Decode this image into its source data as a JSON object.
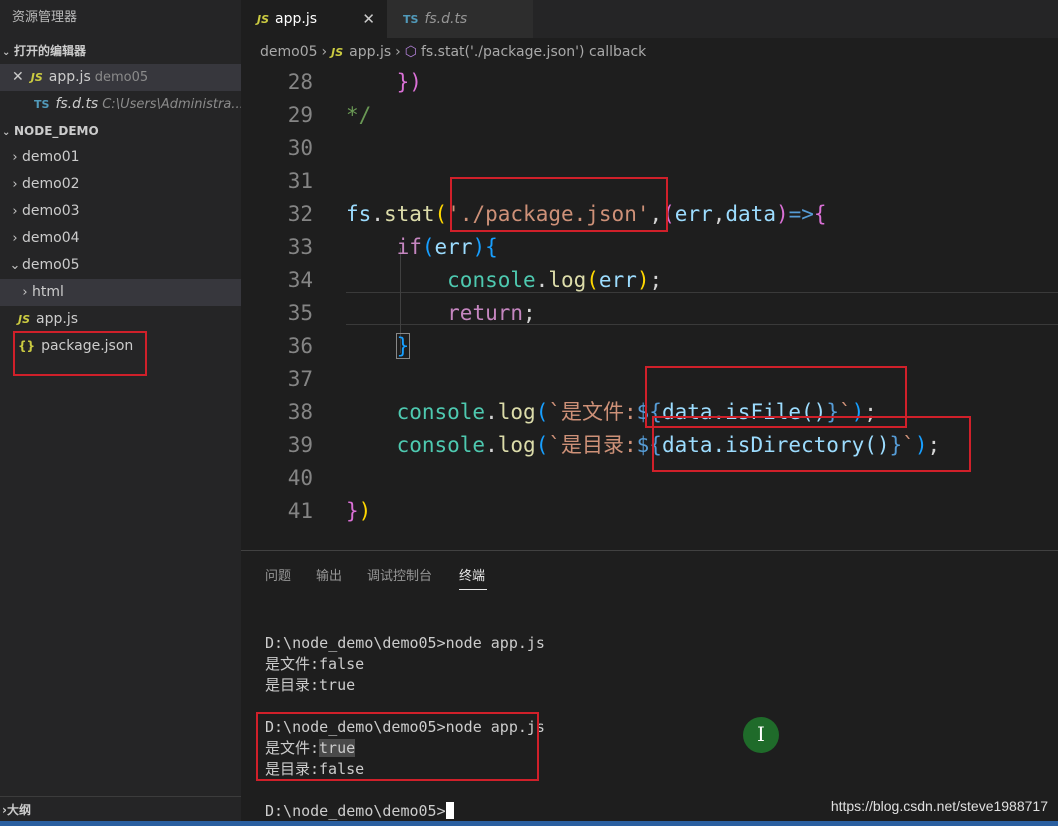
{
  "sidebar": {
    "title": "资源管理器",
    "open_editors_title": "打开的编辑器",
    "open_editors": [
      {
        "icon": "JS",
        "name": "app.js",
        "desc": "demo05"
      },
      {
        "icon": "TS",
        "name": "fs.d.ts",
        "desc": "C:\\Users\\Administra..."
      }
    ],
    "project_title": "NODE_DEMO",
    "folders": [
      "demo01",
      "demo02",
      "demo03",
      "demo04",
      "demo05"
    ],
    "demo05_children": [
      {
        "type": "folder",
        "name": "html"
      },
      {
        "type": "file",
        "icon": "JS",
        "name": "app.js"
      },
      {
        "type": "file",
        "icon": "{}",
        "name": "package.json"
      }
    ],
    "outline_title": "大纲"
  },
  "tabs": [
    {
      "icon": "JS",
      "label": "app.js",
      "close": "✕"
    },
    {
      "icon": "TS",
      "label": "fs.d.ts"
    }
  ],
  "breadcrumb": [
    "demo05",
    "app.js",
    "fs.stat('./package.json') callback"
  ],
  "code_lines": {
    "n28": "28",
    "n29": "29",
    "n30": "30",
    "n31": "31",
    "n32": "32",
    "n33": "33",
    "n34": "34",
    "n35": "35",
    "n36": "36",
    "n37": "37",
    "n38": "38",
    "n39": "39",
    "n40": "40",
    "n41": "41"
  },
  "code": {
    "l28": "})",
    "l29": "*/",
    "l32_fs": "fs",
    "l32_stat": "stat",
    "l32_str": "'./package.json'",
    "l32_err": "err",
    "l32_data": "data",
    "l33_if": "if",
    "l33_err": "err",
    "l34_console": "console",
    "l34_log": "log",
    "l34_err": "err",
    "l35_return": "return",
    "l38_console": "console",
    "l38_log": "log",
    "l38_str": "`是文件:",
    "l38_expr": "data.isFile()",
    "l39_console": "console",
    "l39_log": "log",
    "l39_str": "`是目录:",
    "l39_expr": "data.isDirectory()"
  },
  "panel": {
    "tabs": [
      "问题",
      "输出",
      "调试控制台",
      "终端"
    ],
    "active_tab": "终端",
    "terminal": [
      "D:\\node_demo\\demo05>node app.js",
      "是文件:false",
      "是目录:true",
      "",
      "D:\\node_demo\\demo05>node app.js",
      "是文件:",
      "true",
      "是目录:false",
      "",
      "D:\\node_demo\\demo05>"
    ],
    "cursor_glyph": "I",
    "watermark": "https://blog.csdn.net/steve1988717"
  }
}
